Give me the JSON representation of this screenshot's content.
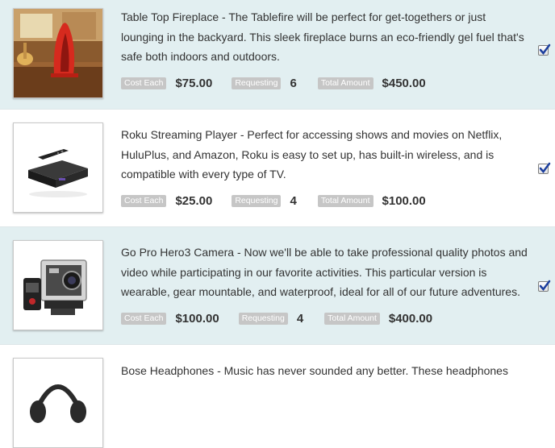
{
  "labels": {
    "cost": "Cost Each",
    "requesting": "Requesting",
    "total": "Total Amount"
  },
  "items": [
    {
      "description": "Table Top Fireplace - The Tablefire will be perfect for get-togethers or just lounging in the backyard. This sleek fireplace burns an eco-friendly gel fuel that's safe both indoors and outdoors.",
      "cost": "$75.00",
      "requesting": "6",
      "total": "$450.00",
      "checked": true,
      "image_icon": "fireplace-image"
    },
    {
      "description": "Roku Streaming Player - Perfect for accessing shows and movies on Netflix, HuluPlus, and Amazon, Roku is easy to set up, has built-in wireless, and is compatible with every type of TV.",
      "cost": "$25.00",
      "requesting": "4",
      "total": "$100.00",
      "checked": true,
      "image_icon": "roku-image"
    },
    {
      "description": "Go Pro Hero3 Camera - Now we'll be able to take professional quality photos and video while participating in our favorite activities. This particular version is wearable, gear mountable, and waterproof, ideal for all of our future adventures.",
      "cost": "$100.00",
      "requesting": "4",
      "total": "$400.00",
      "checked": true,
      "image_icon": "gopro-image"
    },
    {
      "description": "Bose Headphones - Music has never sounded any better. These headphones",
      "image_icon": "headphones-image"
    }
  ],
  "colors": {
    "alt_row": "#e2eff1",
    "tag_bg": "#c6c6c6",
    "check_mark": "#1c3f9e"
  }
}
